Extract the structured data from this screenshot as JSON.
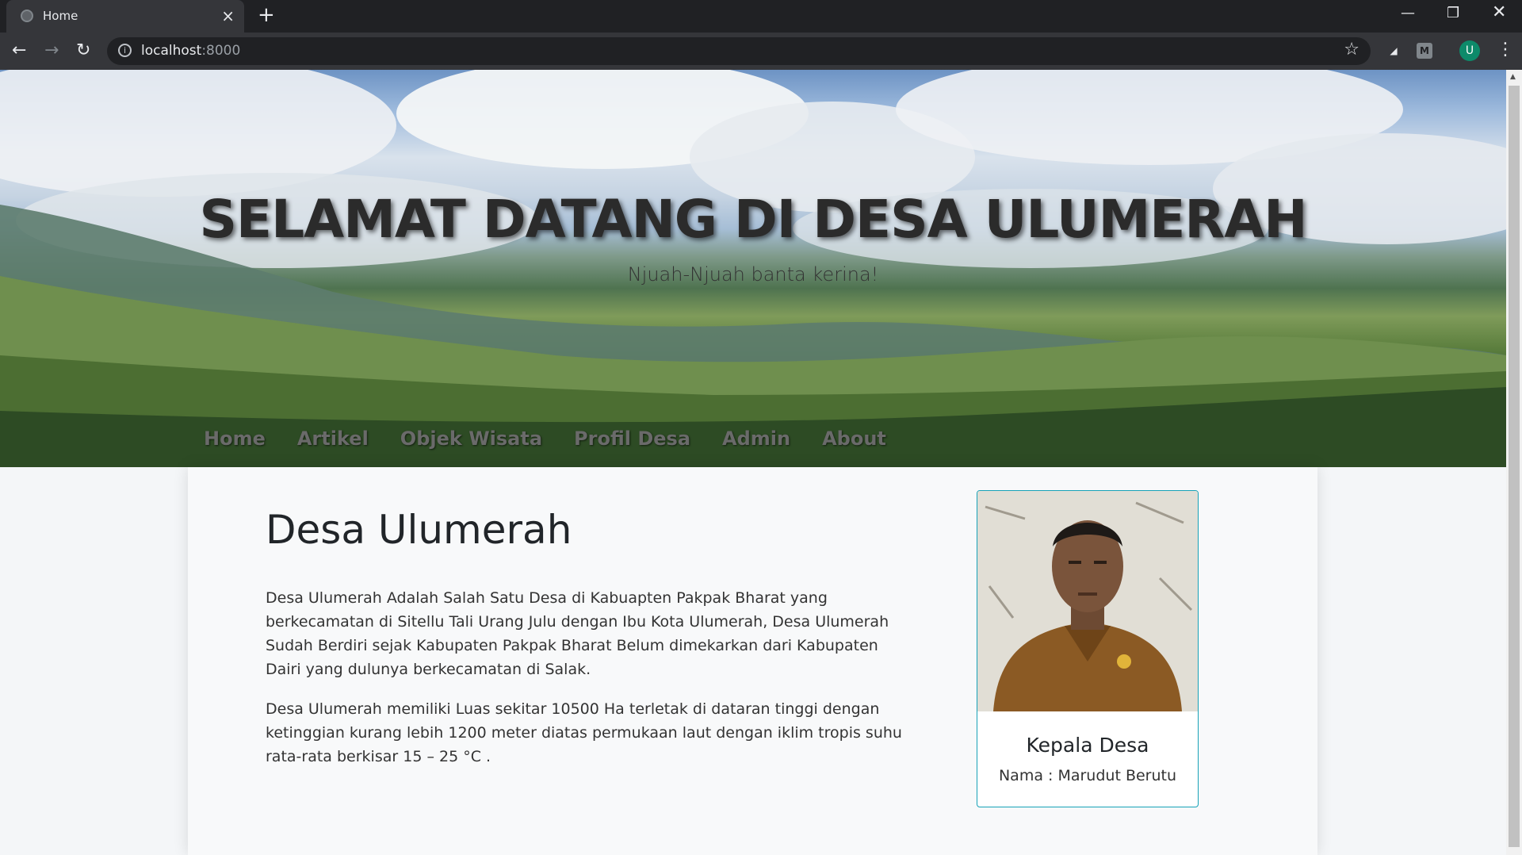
{
  "browser": {
    "tab_title": "Home",
    "url_host": "localhost",
    "url_port": ":8000",
    "profile_initial": "U",
    "extension_label": "M"
  },
  "hero": {
    "title": "SELAMAT DATANG DI DESA ULUMERAH",
    "tagline": "Njuah-Njuah banta kerina!",
    "menu": [
      "Home",
      "Artikel",
      "Objek Wisata",
      "Profil Desa",
      "Admin",
      "About"
    ]
  },
  "main": {
    "heading": "Desa Ulumerah",
    "paragraph1": "Desa Ulumerah Adalah Salah Satu Desa di Kabuapten Pakpak Bharat yang berkecamatan di Sitellu Tali Urang Julu dengan Ibu Kota Ulumerah, Desa Ulumerah Sudah Berdiri sejak Kabupaten Pakpak Bharat Belum dimekarkan dari Kabupaten Dairi yang dulunya berkecamatan di Salak.",
    "paragraph2": "Desa Ulumerah memiliki Luas sekitar 10500 Ha terletak di dataran tinggi dengan ketinggian kurang lebih 1200 meter diatas permukaan laut dengan iklim tropis suhu rata-rata berkisar 15 – 25 °C ."
  },
  "card": {
    "title": "Kepala Desa",
    "nama": "Nama : Marudut Berutu"
  },
  "colors": {
    "card_border": "#17a2b8",
    "avatar_bg": "#0d8a6a"
  }
}
